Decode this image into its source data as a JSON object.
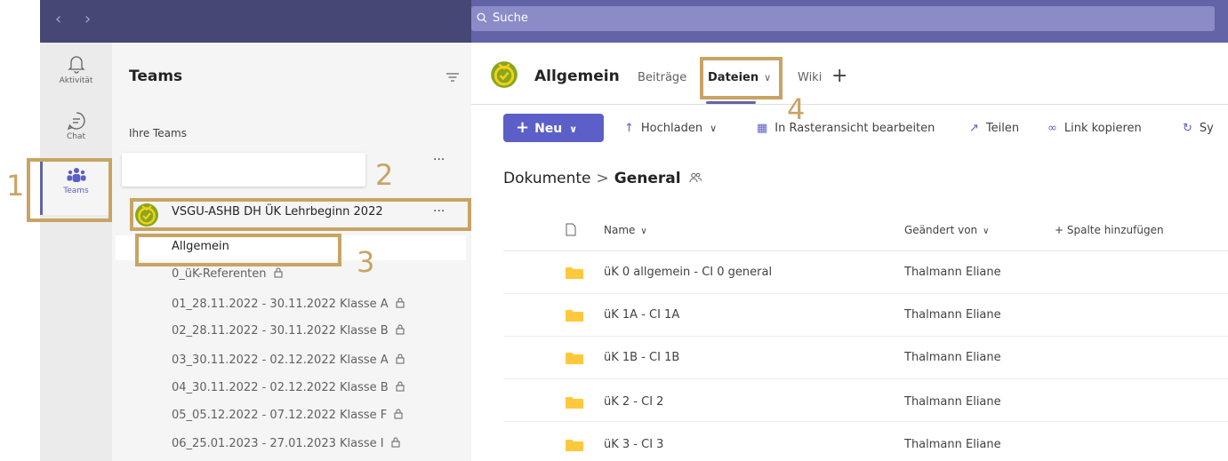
{
  "top": {
    "search_placeholder": "Suche"
  },
  "rail": {
    "items": [
      {
        "label": "Aktivität"
      },
      {
        "label": "Chat"
      },
      {
        "label": "Teams"
      }
    ],
    "active_color": "#6264a7"
  },
  "panel": {
    "title": "Teams",
    "section": "Ihre Teams",
    "team_name": "VSGU-ASHB DH ÜK Lehrbeginn 2022",
    "more": "···",
    "channels": [
      "Allgemein",
      "0_üK-Referenten",
      "01_28.11.2022 - 30.11.2022 Klasse A",
      "02_28.11.2022 - 30.11.2022 Klasse B",
      "03_30.11.2022 - 02.12.2022 Klasse A",
      "04_30.11.2022 - 02.12.2022 Klasse B",
      "05_05.12.2022 - 07.12.2022 Klasse F",
      "06_25.01.2023 - 27.01.2023 Klasse I"
    ]
  },
  "header": {
    "channel_title": "Allgemein",
    "tabs": [
      "Beiträge",
      "Dateien",
      "Wiki"
    ],
    "active_tab": "Dateien",
    "add_tab": "+"
  },
  "toolbar": {
    "new_label": "Neu",
    "upload_label": "Hochladen",
    "grid_label": "In Rasteransicht bearbeiten",
    "share_label": "Teilen",
    "copy_link_label": "Link kopieren",
    "sync_label": "Sy"
  },
  "breadcrumb": {
    "root": "Dokumente",
    "separator": ">",
    "current": "General"
  },
  "table": {
    "columns": {
      "name": "Name",
      "changed_by": "Geändert von",
      "add_column": "+ Spalte hinzufügen"
    },
    "rows": [
      {
        "name": "üK 0 allgemein - CI 0 general",
        "changed_by": "Thalmann Eliane"
      },
      {
        "name": "üK 1A - CI 1A",
        "changed_by": "Thalmann Eliane"
      },
      {
        "name": "üK 1B - CI 1B",
        "changed_by": "Thalmann Eliane"
      },
      {
        "name": "üK 2 - CI 2",
        "changed_by": "Thalmann Eliane"
      },
      {
        "name": "üK 3 - CI 3",
        "changed_by": "Thalmann Eliane"
      }
    ]
  },
  "annotations": {
    "labels": [
      "1",
      "2",
      "3",
      "4"
    ],
    "color": "#c8a464"
  }
}
